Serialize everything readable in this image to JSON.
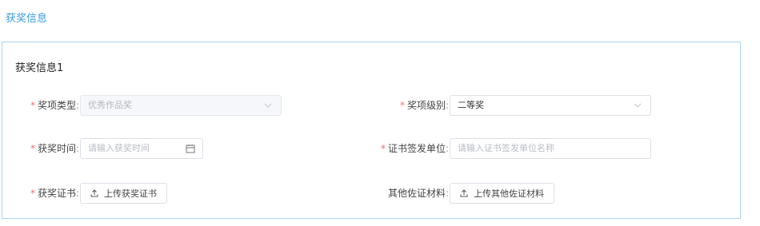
{
  "colors": {
    "accent": "#3a9be0",
    "required": "#f56c6c",
    "border": "#a9d4f2"
  },
  "section": {
    "title": "获奖信息"
  },
  "card": {
    "title": "获奖信息1",
    "fields": {
      "award_type": {
        "label": "奖项类型",
        "value": "优秀作品奖",
        "required": true,
        "disabled": true
      },
      "award_level": {
        "label": "奖项级别",
        "value": "二等奖",
        "required": true
      },
      "award_time": {
        "label": "获奖时间",
        "placeholder": "请输入获奖时间",
        "required": true
      },
      "issuer": {
        "label": "证书签发单位",
        "placeholder": "请输入证书签发单位名称",
        "required": true
      },
      "certificate": {
        "label": "获奖证书",
        "button": "上传获奖证书",
        "required": true
      },
      "other_materials": {
        "label": "其他佐证材料",
        "button": "上传其他佐证材料",
        "required": false
      }
    },
    "colon": ":",
    "required_mark": "*"
  },
  "icons": {
    "select": "chevron-down-icon",
    "date": "calendar-icon",
    "upload": "upload-icon"
  }
}
